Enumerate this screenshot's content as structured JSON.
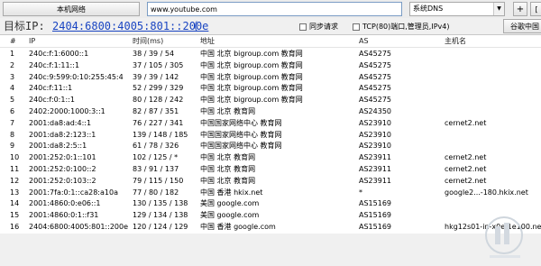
{
  "toolbar": {
    "local_button": "本机网络",
    "url_value": "www.youtube.com",
    "dns_value": "系统DNS",
    "plus_label": "+",
    "edge_label": "["
  },
  "target": {
    "label": "目标IP:",
    "ip": "2404:6800:4005:801::200e",
    "paren": "("
  },
  "options": {
    "sync_label": "同步请求",
    "tcp_label": "TCP(80)端口,管理员,IPv4)"
  },
  "google_button": "谷歌中国",
  "table": {
    "headers": [
      "#",
      "IP",
      "时间(ms)",
      "地址",
      "AS",
      "主机名"
    ],
    "rows": [
      [
        "1",
        "240c:f:1:6000::1",
        "38 / 39 / 54",
        "中国 北京 bigroup.com 教育网",
        "AS45275",
        ""
      ],
      [
        "2",
        "240c:f:1:11::1",
        "37 / 105 / 305",
        "中国 北京 bigroup.com 教育网",
        "AS45275",
        ""
      ],
      [
        "3",
        "240c:9:599:0:10:255:45:4",
        "39 / 39 / 142",
        "中国 北京 bigroup.com 教育网",
        "AS45275",
        ""
      ],
      [
        "4",
        "240c:f:11::1",
        "52 / 299 / 329",
        "中国 北京 bigroup.com 教育网",
        "AS45275",
        ""
      ],
      [
        "5",
        "240c:f:0:1::1",
        "80 / 128 / 242",
        "中国 北京 bigroup.com 教育网",
        "AS45275",
        ""
      ],
      [
        "6",
        "2402:2000:1000:3::1",
        "82 / 87 / 351",
        "中国 北京 教育网",
        "AS24350",
        ""
      ],
      [
        "7",
        "2001:da8:ad:4::1",
        "76 / 227 / 341",
        "中国国家网络中心 教育网",
        "AS23910",
        "cernet2.net"
      ],
      [
        "8",
        "2001:da8:2:123::1",
        "139 / 148 / 185",
        "中国国家网络中心 教育网",
        "AS23910",
        ""
      ],
      [
        "9",
        "2001:da8:2:5::1",
        "61 / 78 / 326",
        "中国国家网络中心 教育网",
        "AS23910",
        ""
      ],
      [
        "10",
        "2001:252:0:1::101",
        "102 / 125 / *",
        "中国 北京 教育网",
        "AS23911",
        "cernet2.net"
      ],
      [
        "11",
        "2001:252:0:100::2",
        "83 / 91 / 137",
        "中国 北京 教育网",
        "AS23911",
        "cernet2.net"
      ],
      [
        "12",
        "2001:252:0:103::2",
        "79 / 115 / 150",
        "中国 北京 教育网",
        "AS23911",
        "cernet2.net"
      ],
      [
        "13",
        "2001:7fa:0:1::ca28:a10a",
        "77 / 80 / 182",
        "中国 香港 hkix.net",
        "*",
        "google2...-180.hkix.net"
      ],
      [
        "14",
        "2001:4860:0:e06::1",
        "130 / 135 / 138",
        "美国 google.com",
        "AS15169",
        ""
      ],
      [
        "15",
        "2001:4860:0:1::f31",
        "129 / 134 / 138",
        "美国 google.com",
        "AS15169",
        ""
      ],
      [
        "16",
        "2404:6800:4005:801::200e",
        "120 / 124 / 129",
        "中国 香港 google.com",
        "AS15169",
        "hkg12s01-in-x0e.1e100.net"
      ]
    ]
  },
  "colors": {
    "link_blue": "#1a45c2",
    "background": "#f0f0f0"
  }
}
